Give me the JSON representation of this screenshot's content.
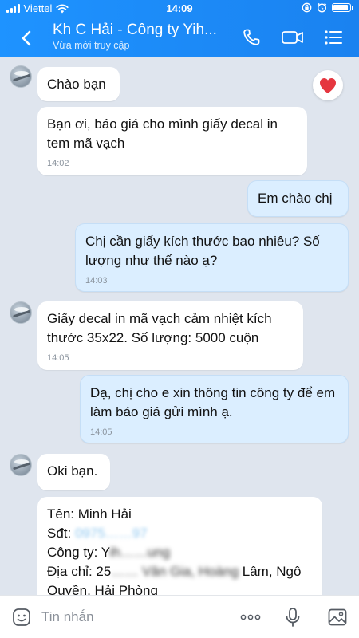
{
  "status_bar": {
    "carrier": "Viettel",
    "time": "14:09"
  },
  "header": {
    "title": "Kh C Hải - Công ty Yih...",
    "subtitle": "Vừa mới truy cập"
  },
  "messages": [
    {
      "dir": "in",
      "text": "Chào bạn",
      "time": "",
      "reaction": "heart"
    },
    {
      "dir": "in",
      "text": "Bạn ơi, báo giá cho mình giấy decal in tem mã vạch",
      "time": "14:02"
    },
    {
      "dir": "out",
      "text": "Em chào chị",
      "time": ""
    },
    {
      "dir": "out",
      "text": "Chị cần giấy kích thước bao nhiêu? Số lượng như thế nào ạ?",
      "time": "14:03"
    },
    {
      "dir": "in",
      "text": "Giấy decal in mã vạch cảm nhiệt kích thước 35x22. Số lượng: 5000 cuộn",
      "time": "14:05"
    },
    {
      "dir": "out",
      "text": "Dạ, chị cho e xin thông tin công ty để em làm báo giá gửi mình ạ.",
      "time": "14:05"
    },
    {
      "dir": "in",
      "text": "Oki bạn.",
      "time": ""
    }
  ],
  "info_card": {
    "name_label": "Tên: Minh Hải",
    "phone_label": "Sđt: ",
    "phone_value": "0975……97",
    "company_label": "Công ty: Y",
    "company_value": "ih……ung",
    "address_label": "Địa chỉ: 25",
    "address_value": "…… Vân Gia, Hoàng ",
    "address_tail": "Lâm, Ngô",
    "address_line2": "Quyền, Hải Phòng"
  },
  "input_bar": {
    "placeholder": "Tin nhắn"
  },
  "colors": {
    "header_blue": "#1a82f0",
    "outgoing_bubble": "#dbeeff",
    "incoming_bubble": "#ffffff",
    "chat_background": "#dfe5ee",
    "reaction_heart": "#e5363f"
  },
  "icons": {
    "status": [
      "signal-icon",
      "wifi-icon",
      "rotation-lock-icon",
      "alarm-icon",
      "battery-icon"
    ],
    "header": [
      "back-icon",
      "phone-icon",
      "video-call-icon",
      "menu-list-icon"
    ],
    "input": [
      "sticker-icon",
      "more-icon",
      "microphone-icon",
      "image-icon"
    ]
  }
}
